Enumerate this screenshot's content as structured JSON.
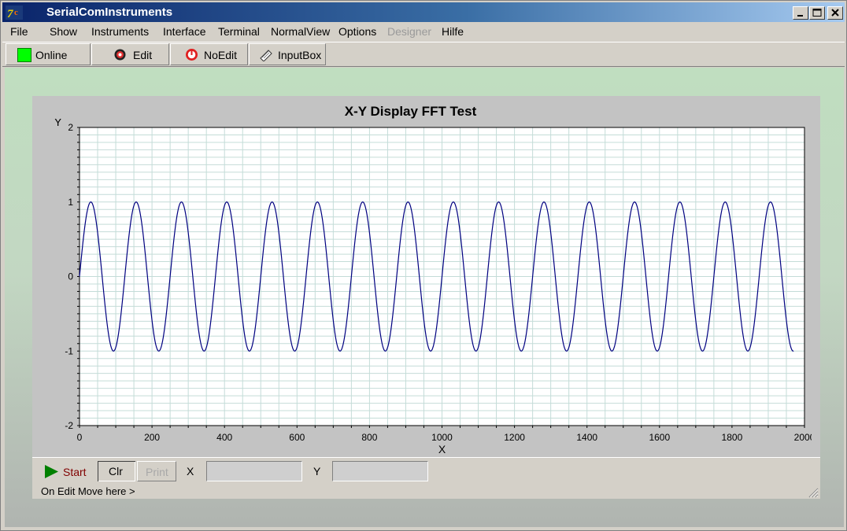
{
  "window": {
    "title": "SerialComInstruments"
  },
  "menu": [
    "File",
    "Show",
    "Instruments",
    "Interface",
    "Terminal",
    "NormalView",
    "Options",
    "Designer",
    "Hilfe"
  ],
  "toolbar": {
    "online": "Online",
    "edit": "Edit",
    "noedit": "NoEdit",
    "inputbox": "InputBox",
    "online_color": "#00ff00"
  },
  "chart_data": {
    "type": "line",
    "title": "X-Y  Display FFT Test",
    "xlabel": "X",
    "ylabel": "Y",
    "xlim": [
      0,
      2000
    ],
    "ylim": [
      -2,
      2
    ],
    "x_ticks": [
      "0",
      "200",
      "400",
      "600",
      "800",
      "1000",
      "1200",
      "1400",
      "1600",
      "1800",
      "2000"
    ],
    "y_ticks": [
      "2",
      "1",
      "0",
      "-1",
      "-2"
    ],
    "grid": true,
    "line_color": "#000080",
    "series": [
      {
        "function": "sin",
        "amplitude": 1,
        "period": 125,
        "x_start": 0,
        "x_end": 1970
      }
    ]
  },
  "controls": {
    "start": "Start",
    "clr": "Clr",
    "print": "Print",
    "x_label": "X",
    "y_label": "Y",
    "x_value": "",
    "y_value": ""
  },
  "status": {
    "text": "On Edit Move here >"
  }
}
